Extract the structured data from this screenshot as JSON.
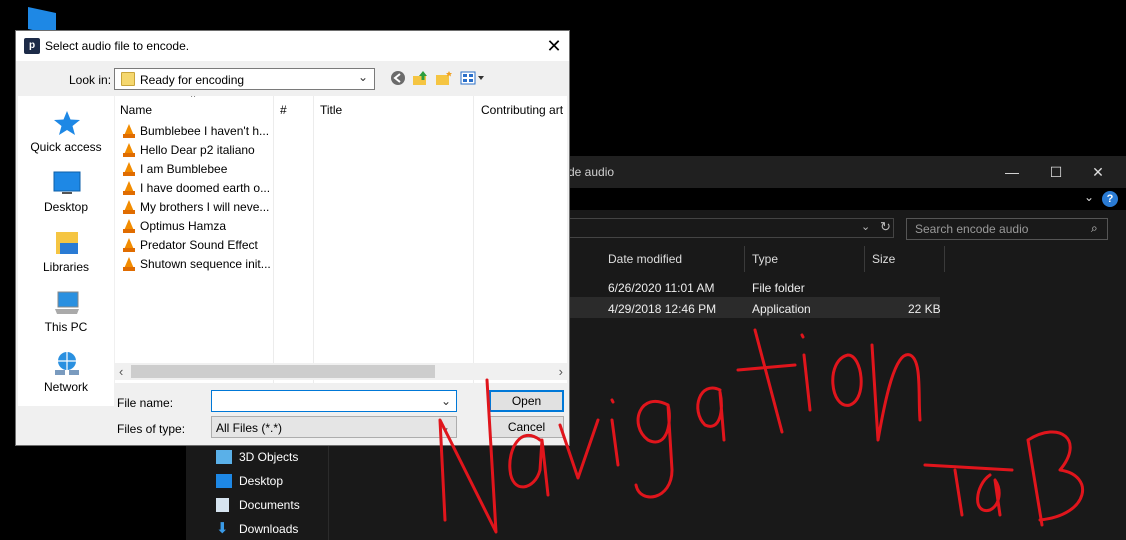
{
  "dialog": {
    "title": "Select audio file to encode.",
    "app_icon_letter": "p",
    "close_glyph": "✕",
    "look_in_label": "Look in:",
    "look_in_value": "Ready for encoding",
    "toolbar_icons": [
      "back-icon",
      "up-folder-icon",
      "new-folder-icon",
      "view-menu-icon"
    ],
    "places": [
      "Quick access",
      "Desktop",
      "Libraries",
      "This PC",
      "Network"
    ],
    "columns": [
      "Name",
      "#",
      "Title",
      "Contributing art"
    ],
    "files": [
      "Bumblebee I haven't h...",
      "Hello Dear p2 italiano",
      "I am Bumblebee",
      "I have doomed earth o...",
      "My brothers I will neve...",
      "Optimus Hamza",
      "Predator Sound Effect",
      "Shutown sequence init..."
    ],
    "file_name_label": "File name:",
    "file_name_value": "",
    "files_of_type_label": "Files of type:",
    "files_of_type_value": "All Files (*.*)",
    "open_label": "Open",
    "cancel_label": "Cancel"
  },
  "explorer": {
    "title_partial": "de audio",
    "window_controls": [
      "—",
      "☐",
      "✕"
    ],
    "search_placeholder": "Search encode audio",
    "columns": [
      "Date modified",
      "Type",
      "Size"
    ],
    "rows": [
      {
        "date": "6/26/2020 11:01 AM",
        "type": "File folder",
        "size": ""
      },
      {
        "date": "4/29/2018 12:46 PM",
        "type": "Application",
        "size": "22 KB"
      }
    ],
    "nav_items": [
      "3D Objects",
      "Desktop",
      "Documents",
      "Downloads"
    ]
  },
  "annotation": {
    "text": [
      "Navigation",
      "TaB"
    ],
    "color": "#e0151c"
  }
}
